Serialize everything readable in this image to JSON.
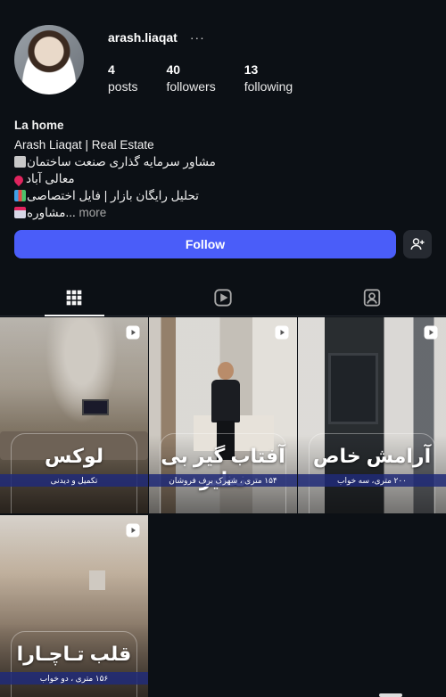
{
  "profile": {
    "username": "arash.liaqat",
    "more_label": "···",
    "stats": [
      {
        "value": "4",
        "label": "posts"
      },
      {
        "value": "40",
        "label": "followers"
      },
      {
        "value": "13",
        "label": "following"
      }
    ]
  },
  "bio": {
    "name": "La home",
    "line1": "Arash Liaqat | Real Estate",
    "line2": "مشاور سرمایه گذاری صنعت ساختمان",
    "line3": "معالی آباد",
    "line4": "تحلیل رایگان بازار | فایل اختصاصی",
    "line5": "مشاوره...",
    "more": "more"
  },
  "actions": {
    "follow_label": "Follow"
  },
  "tabs": [
    "posts-grid",
    "reels",
    "tagged"
  ],
  "posts": [
    {
      "title": "لوکس",
      "caption": "تکمیل و دیدنی"
    },
    {
      "title": "آفتاب گیر بی نظیر",
      "caption": "۱۵۴ متری ، شهرک برف فروشان"
    },
    {
      "title": "آرامش خاص",
      "caption": "۲۰۰ متری، سه خواب"
    },
    {
      "title": "قلب تـاچـارا",
      "caption": "۱۵۶ متری ، دو خواب"
    }
  ],
  "colors": {
    "background": "#0c1015",
    "accent": "#4a5df9",
    "secondary_button": "#262a31"
  }
}
